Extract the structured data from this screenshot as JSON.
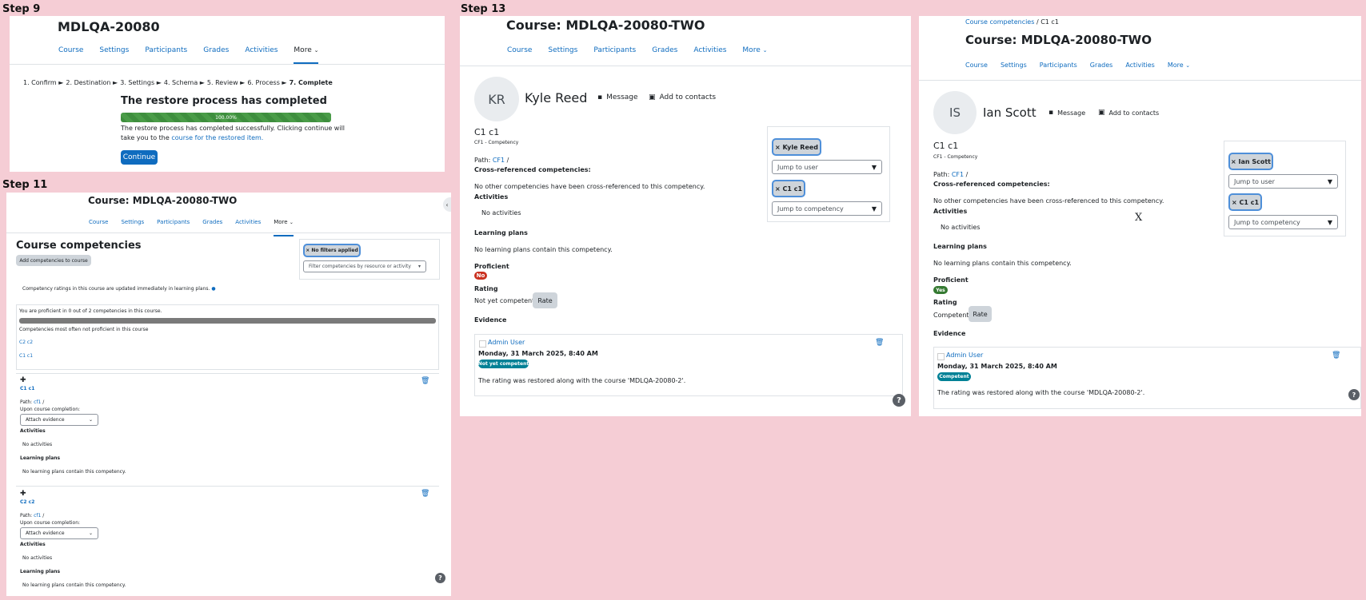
{
  "steps": {
    "s9": "Step 9",
    "s11": "Step 11",
    "s13": "Step 13"
  },
  "nav": [
    "Course",
    "Settings",
    "Participants",
    "Grades",
    "Activities",
    "More"
  ],
  "step9": {
    "course_title": "MDLQA-20080",
    "crumbs": [
      "1. Confirm ►",
      "2. Destination ►",
      "3. Settings ►",
      "4. Schema ►",
      "5. Review ►",
      "6. Process ►",
      "7. Complete"
    ],
    "heading": "The restore process has completed",
    "progress_label": "100.00%",
    "progress_fraction": 1.0,
    "message_line1": "The restore process has completed successfully. Clicking continue will",
    "message_line2_prefix": "take you to the",
    "message_link": "course for the restored item.",
    "continue": "Continue"
  },
  "step11": {
    "course_title": "Course: MDLQA-20080-TWO",
    "page_title": "Course competencies",
    "add_button": "Add competencies to course",
    "filter_pill": "× No filters applied",
    "filter_placeholder": "Filter competencies by resource or activity",
    "ratings_note": "Competency ratings in this course are updated immediately in learning plans.",
    "proficient_summary": "You are proficient in 0 out of 2 competencies in this course.",
    "progress_fraction": 0.0,
    "most_often": "Competencies most often not proficient in this course",
    "list": [
      "C2 c2",
      "C1 c1"
    ],
    "cards": [
      {
        "name": "C1 c1",
        "path_label": "Path:",
        "path_link": "cf1",
        "upon": "Upon course completion:",
        "select": "Attach evidence",
        "activities": "Activities",
        "no_activities": "No activities",
        "plans": "Learning plans",
        "no_plans": "No learning plans contain this competency."
      },
      {
        "name": "C2 c2",
        "path_label": "Path:",
        "path_link": "cf1",
        "upon": "Upon course completion:",
        "select": "Attach evidence",
        "activities": "Activities",
        "no_activities": "No activities",
        "plans": "Learning plans",
        "no_plans": "No learning plans contain this competency."
      }
    ]
  },
  "step13a": {
    "course_title": "Course: MDLQA-20080-TWO",
    "initials": "KR",
    "user": "Kyle Reed",
    "message": "Message",
    "add_contacts": "Add to contacts",
    "comp_name": "C1 c1",
    "framework": "CF1 - Competency",
    "path_label": "Path:",
    "path_link": "CF1",
    "cross_ref": "Cross-referenced competencies:",
    "no_cross": "No other competencies have been cross-referenced to this competency.",
    "activities": "Activities",
    "no_activities": "No activities",
    "plans": "Learning plans",
    "no_plans": "No learning plans contain this competency.",
    "proficient": "Proficient",
    "proficient_badge": "No",
    "rating": "Rating",
    "rating_value": "Not yet competent",
    "rate": "Rate",
    "evidence": "Evidence",
    "ev_user": "Admin User",
    "ev_date": "Monday, 31 March 2025, 8:40 AM",
    "ev_badge": "Not yet competent",
    "ev_text": "The rating was restored along with the course 'MDLQA-20080-2'.",
    "pill_user": "× Kyle Reed",
    "jump_user": "Jump to user",
    "pill_comp": "× C1 c1",
    "jump_comp": "Jump to competency",
    "colors": {
      "badge": "#ca3120",
      "ev_badge": "#008196"
    }
  },
  "step13b": {
    "breadcrumb_link": "Course competencies",
    "breadcrumb_sep": "/",
    "breadcrumb_current": "C1 c1",
    "course_title": "Course: MDLQA-20080-TWO",
    "initials": "IS",
    "user": "Ian Scott",
    "message": "Message",
    "add_contacts": "Add to contacts",
    "comp_name": "C1 c1",
    "framework": "CF1 - Competency",
    "path_label": "Path:",
    "path_link": "CF1",
    "cross_ref": "Cross-referenced competencies:",
    "no_cross": "No other competencies have been cross-referenced to this competency.",
    "activities": "Activities",
    "no_activities": "No activities",
    "plans": "Learning plans",
    "no_plans": "No learning plans contain this competency.",
    "proficient": "Proficient",
    "proficient_badge": "Yes",
    "rating": "Rating",
    "rating_value": "Competent",
    "rate": "Rate",
    "evidence": "Evidence",
    "ev_user": "Admin User",
    "ev_date": "Monday, 31 March 2025, 8:40 AM",
    "ev_badge": "Competent",
    "ev_text": "The rating was restored along with the course 'MDLQA-20080-2'.",
    "pill_user": "× Ian Scott",
    "jump_user": "Jump to user",
    "pill_comp": "× C1 c1",
    "jump_comp": "Jump to competency",
    "stray": "X",
    "colors": {
      "badge": "#357a32",
      "ev_badge": "#008196"
    }
  }
}
